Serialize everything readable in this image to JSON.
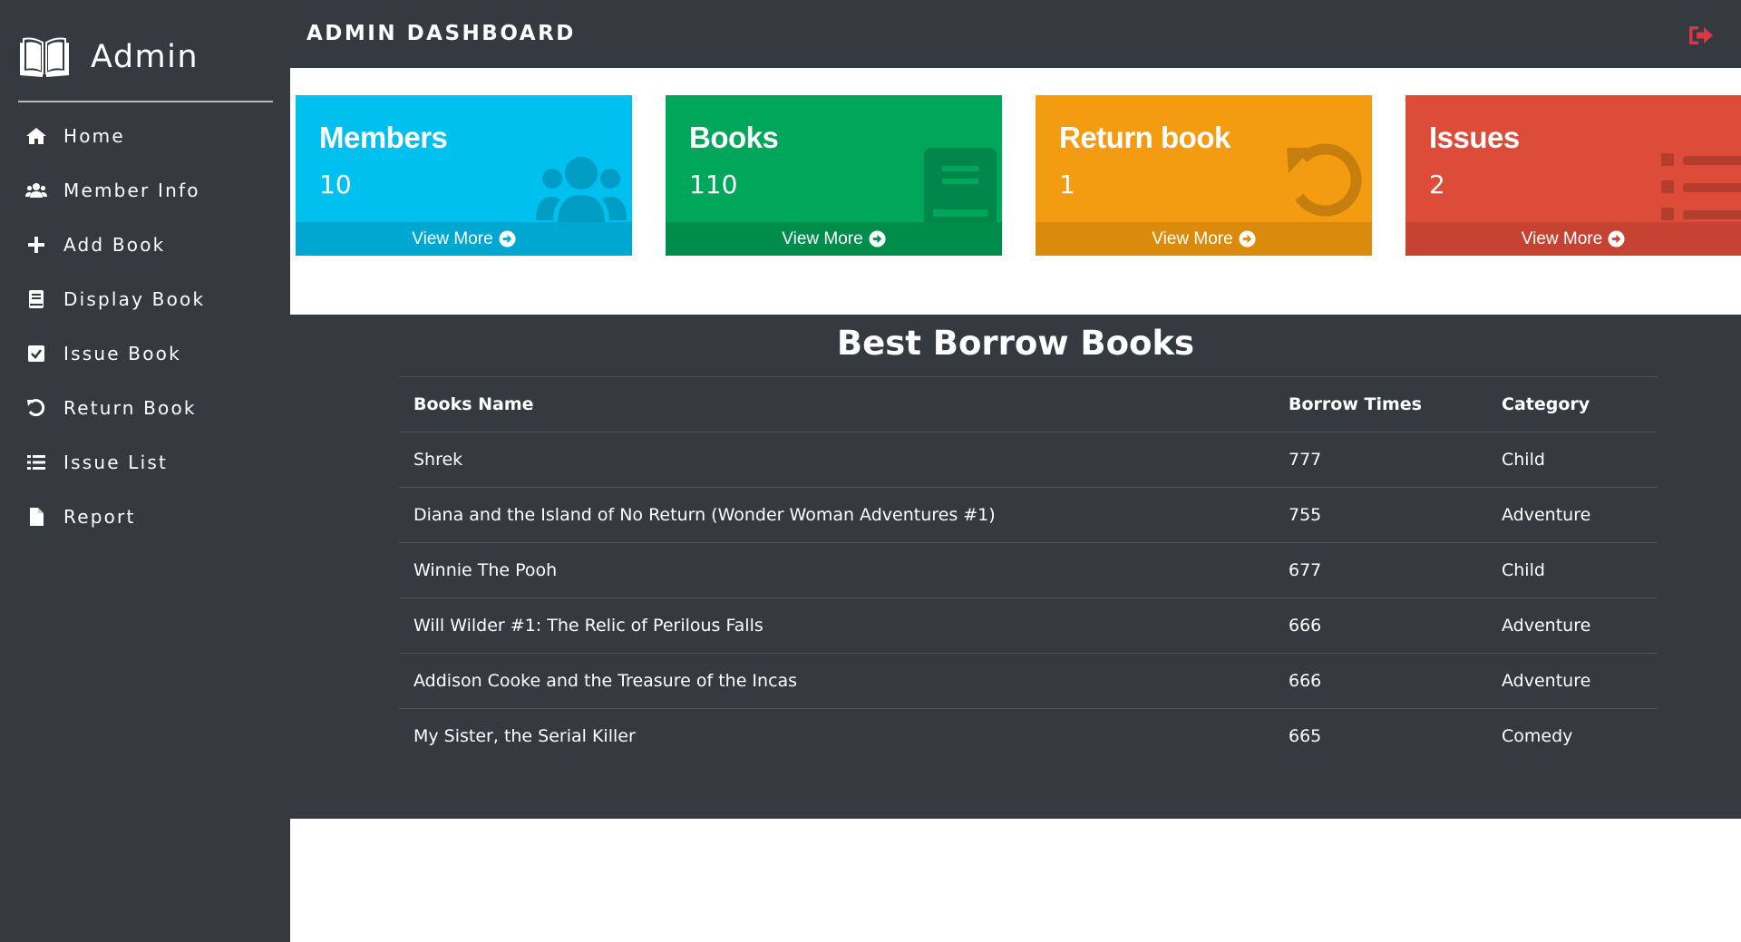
{
  "brand": {
    "title": "Admin",
    "icon": "open-book-icon"
  },
  "header": {
    "title": "ADMIN DASHBOARD",
    "logout_icon": "sign-out-icon",
    "logout_color": "#dc3545"
  },
  "sidebar": {
    "items": [
      {
        "label": "Home",
        "icon": "home-icon"
      },
      {
        "label": "Member Info",
        "icon": "users-icon"
      },
      {
        "label": "Add Book",
        "icon": "plus-icon"
      },
      {
        "label": "Display Book",
        "icon": "book-icon"
      },
      {
        "label": "Issue Book",
        "icon": "check-square-icon"
      },
      {
        "label": "Return Book",
        "icon": "undo-icon"
      },
      {
        "label": "Issue List",
        "icon": "list-icon"
      },
      {
        "label": "Report",
        "icon": "file-icon"
      }
    ]
  },
  "cards": [
    {
      "title": "Members",
      "count": "10",
      "footer": "View More",
      "color": "#00c0ef",
      "footer_color": "#00a7d0",
      "icon": "users-icon"
    },
    {
      "title": "Books",
      "count": "110",
      "footer": "View More",
      "color": "#00a65a",
      "footer_color": "#008d4c",
      "icon": "book-icon"
    },
    {
      "title": "Return book",
      "count": "1",
      "footer": "View More",
      "color": "#f39c12",
      "footer_color": "#db8b0b",
      "icon": "undo-icon"
    },
    {
      "title": "Issues",
      "count": "2",
      "footer": "View More",
      "color": "#dd4b39",
      "footer_color": "#c64333",
      "icon": "list-icon"
    }
  ],
  "table": {
    "title": "Best Borrow Books",
    "headers": [
      "Books Name",
      "Borrow Times",
      "Category"
    ],
    "rows": [
      [
        "Shrek",
        "777",
        "Child"
      ],
      [
        "Diana and the Island of No Return (Wonder Woman Adventures #1)",
        "755",
        "Adventure"
      ],
      [
        "Winnie The Pooh",
        "677",
        "Child"
      ],
      [
        "Will Wilder #1: The Relic of Perilous Falls",
        "666",
        "Adventure"
      ],
      [
        "Addison Cooke and the Treasure of the Incas",
        "666",
        "Adventure"
      ],
      [
        "My Sister, the Serial Killer",
        "665",
        "Comedy"
      ]
    ]
  }
}
